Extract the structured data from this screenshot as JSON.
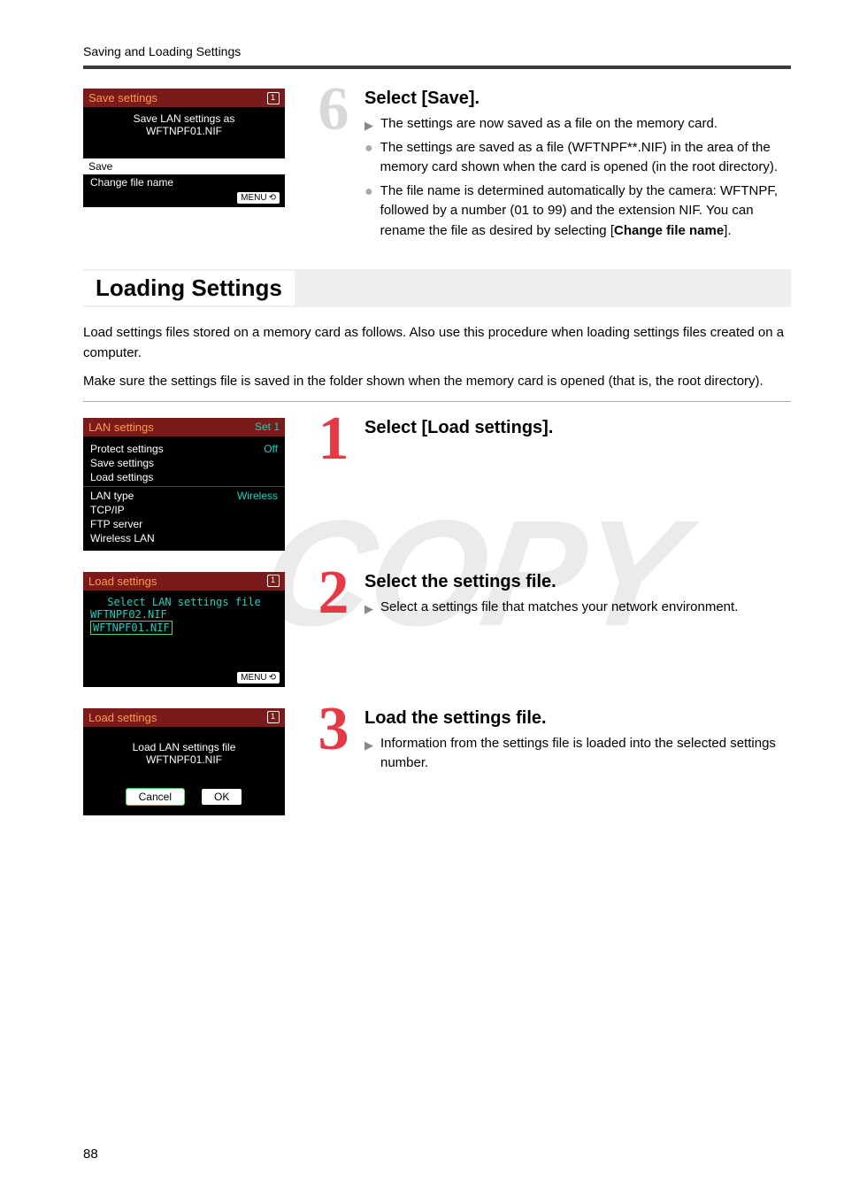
{
  "header": {
    "breadcrumb": "Saving and Loading Settings"
  },
  "watermark": "COPY",
  "step6": {
    "number": "6",
    "title": "Select [Save].",
    "items": [
      {
        "type": "arrow",
        "text": "The settings are now saved as a file on the memory card."
      },
      {
        "type": "bullet",
        "text": "The settings are saved as a file (WFTNPF**.NIF) in the area of the memory card shown when the card is opened (in the root directory)."
      },
      {
        "type": "bullet",
        "text_pre": "The file name is determined automatically by the camera: WFTNPF, followed by a number (01 to 99) and the extension NIF. You can rename the file as desired by selecting [",
        "bold": "Change file name",
        "text_post": "]."
      }
    ],
    "lcd": {
      "title": "Save settings",
      "line1": "Save LAN settings as",
      "line2": "WFTNPF01.NIF",
      "opt_save": "Save",
      "opt_change": "Change file name",
      "menu": "MENU"
    }
  },
  "loading": {
    "heading": "Loading Settings",
    "intro1": "Load settings files stored on a memory card as follows. Also use this procedure when loading settings files created on a computer.",
    "intro2": "Make sure the settings file is saved in the folder shown when the memory card is opened (that is, the root directory)."
  },
  "step1": {
    "number": "1",
    "title": "Select [Load settings].",
    "lcd": {
      "title": "LAN settings",
      "set": "Set 1",
      "rows": [
        {
          "l": "Protect settings",
          "r": "Off"
        },
        {
          "l": "Save settings",
          "r": ""
        },
        {
          "l": "Load settings",
          "r": ""
        }
      ],
      "rows2": [
        {
          "l": "LAN type",
          "r": "Wireless"
        },
        {
          "l": "TCP/IP",
          "r": ""
        },
        {
          "l": "FTP server",
          "r": ""
        },
        {
          "l": "Wireless LAN",
          "r": ""
        }
      ]
    }
  },
  "step2": {
    "number": "2",
    "title": "Select the settings file.",
    "items": [
      {
        "type": "arrow",
        "text": "Select a settings file that matches your network environment."
      }
    ],
    "lcd": {
      "title": "Load settings",
      "subtitle": "Select LAN settings file",
      "file1": "WFTNPF02.NIF",
      "file2": "WFTNPF01.NIF",
      "menu": "MENU"
    }
  },
  "step3": {
    "number": "3",
    "title": "Load the settings file.",
    "items": [
      {
        "type": "arrow",
        "text": "Information from the settings file is loaded into the selected settings number."
      }
    ],
    "lcd": {
      "title": "Load settings",
      "line1": "Load LAN settings file",
      "line2": "WFTNPF01.NIF",
      "cancel": "Cancel",
      "ok": "OK"
    }
  },
  "page_number": "88"
}
